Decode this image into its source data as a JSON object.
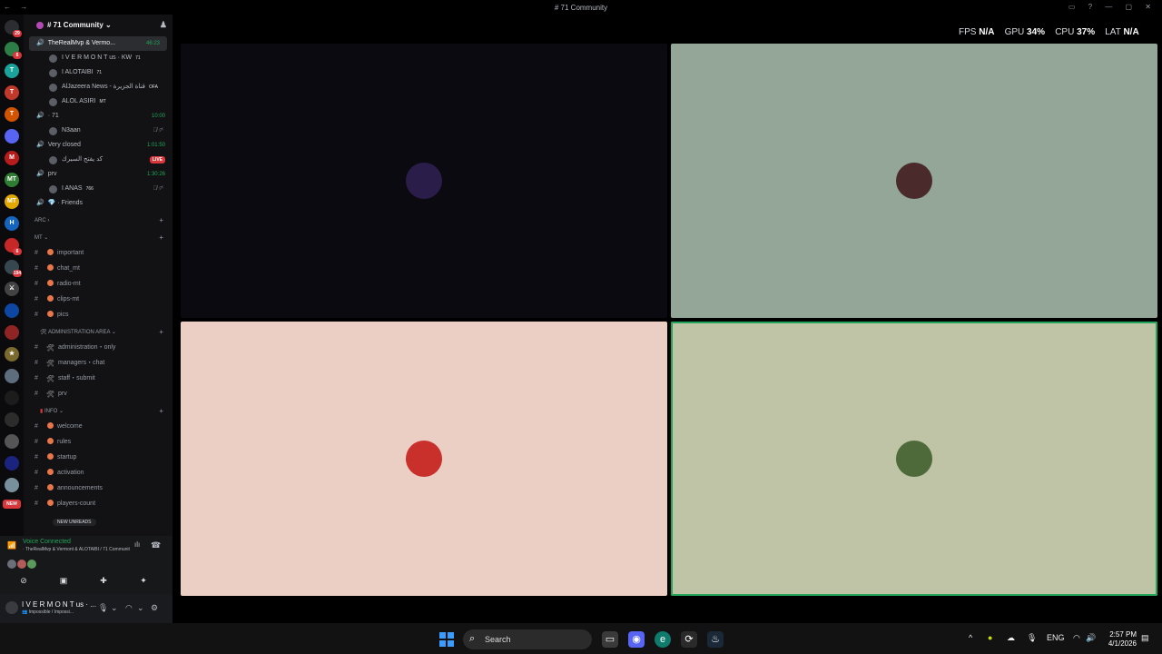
{
  "window": {
    "title": "# 71 Community",
    "nav_glyphs": "← →",
    "controls_glyphs": "▭ ? — ▢ ✕"
  },
  "server_list": {
    "items": [
      {
        "icon": "discord-home-icon",
        "color": "#2b2d31",
        "badge": "29",
        "label": ""
      },
      {
        "icon": "server-icon",
        "color": "#2d7d46",
        "badge": "6",
        "label": ""
      },
      {
        "icon": "server-icon",
        "color": "#1aa39a",
        "badge": "",
        "label": "T"
      },
      {
        "icon": "server-icon",
        "color": "#c0392b",
        "badge": "",
        "label": "T"
      },
      {
        "icon": "server-icon",
        "color": "#d35400",
        "badge": "",
        "label": "T"
      },
      {
        "icon": "server-icon",
        "color": "#5865f2",
        "badge": "",
        "label": ""
      },
      {
        "icon": "server-icon",
        "color": "#b71c1c",
        "badge": "",
        "label": "M"
      },
      {
        "icon": "server-icon",
        "color": "#2e7d32",
        "badge": "",
        "label": "MT"
      },
      {
        "icon": "server-icon",
        "color": "#e0a800",
        "badge": "",
        "label": "MT"
      },
      {
        "icon": "server-icon",
        "color": "#1565c0",
        "badge": "",
        "label": "H"
      },
      {
        "icon": "server-icon",
        "color": "#c62828",
        "badge": "6",
        "label": ""
      },
      {
        "icon": "server-icon",
        "color": "#37474f",
        "badge": "194",
        "label": ""
      },
      {
        "icon": "server-icon",
        "color": "#424242",
        "badge": "",
        "label": "⚔"
      },
      {
        "icon": "server-icon",
        "color": "#0d47a1",
        "badge": "",
        "label": ""
      },
      {
        "icon": "server-icon",
        "color": "#8e2424",
        "badge": "",
        "label": ""
      },
      {
        "icon": "server-icon",
        "color": "#7a6a2e",
        "badge": "",
        "label": "★"
      },
      {
        "icon": "server-icon",
        "color": "#5d6d7e",
        "badge": "",
        "label": ""
      },
      {
        "icon": "server-icon",
        "color": "#1c1c1c",
        "badge": "",
        "label": ""
      },
      {
        "icon": "server-icon",
        "color": "#2c2c2c",
        "badge": "",
        "label": ""
      },
      {
        "icon": "server-icon",
        "color": "#555",
        "badge": "",
        "label": ""
      },
      {
        "icon": "server-icon",
        "color": "#1a237e",
        "badge": "",
        "label": ""
      },
      {
        "icon": "server-icon",
        "color": "#78909c",
        "badge": "",
        "label": ""
      }
    ],
    "new_label": "NEW"
  },
  "sidebar": {
    "guild_name": "# 71 Community ⌄",
    "voice": [
      {
        "name": "TheRealMvp & Vermo...",
        "timer": "46:23",
        "active": true,
        "users": [
          {
            "name": "I V E R M O N T us · KW",
            "tag": "71"
          },
          {
            "name": "I ALOTAIBI",
            "tag": "71"
          },
          {
            "name": "AlJazeera News - قناة الجزيرة",
            "tag": "OFA"
          },
          {
            "name": "ALOL ASIRI",
            "tag": "MT"
          }
        ]
      },
      {
        "name": "· 71",
        "timer": "10:00",
        "active": false,
        "users": [
          {
            "name": "N3aan",
            "tag": ""
          }
        ]
      },
      {
        "name": "Very closed",
        "timer": "1:01:50",
        "active": false,
        "users": [
          {
            "name": "كد يفتح السيرك",
            "tag": "",
            "live": "LIVE"
          }
        ]
      },
      {
        "name": "prv",
        "timer": "1:30:26",
        "active": false,
        "users": [
          {
            "name": "I ANAS",
            "tag": "766"
          }
        ]
      },
      {
        "name": "💎 · Friends",
        "timer": "",
        "active": false,
        "users": []
      }
    ],
    "categories": {
      "arc": "ARC ›",
      "mt": "MT ⌄",
      "admin": "Administration Area ⌄",
      "info": "INFO ⌄"
    },
    "mt_channels": [
      "important",
      "chat_mt",
      "radio-mt",
      "clips-mt",
      "pics"
    ],
    "admin_channels": [
      "administration・only",
      "managers・chat",
      "staff・submit",
      "prv"
    ],
    "info_channels": [
      "welcome",
      "rules",
      "startup",
      "activation",
      "announcements",
      "players-count"
    ],
    "new_unreads": "NEW UNREADS"
  },
  "voice_panel": {
    "status": "Voice Connected",
    "channel": "· TheRealMvp & Vermont & ALOTAIBI / 71 Community"
  },
  "user_bar": {
    "name": "I V E R M O N T us · ...",
    "status": "👥 Impossible / Impossi..."
  },
  "hud": {
    "fps_label": "FPS",
    "fps_value": "N/A",
    "gpu_label": "GPU",
    "gpu_value": "34%",
    "cpu_label": "CPU",
    "cpu_value": "37%",
    "lat_label": "LAT",
    "lat_value": "N/A"
  },
  "tiles": [
    {
      "bg": "#0b0a10",
      "avatar": "#2a1d4a",
      "speaking": false
    },
    {
      "bg": "#93a697",
      "avatar": "#4a2a2a",
      "speaking": false
    },
    {
      "bg": "#ebcfc4",
      "avatar": "#c9302c",
      "speaking": false
    },
    {
      "bg": "#bec4a5",
      "avatar": "#4f6a3a",
      "speaking": true
    }
  ],
  "taskbar": {
    "search_label": "Search",
    "lang": "ENG",
    "time": "2:57 PM",
    "date": "4/1/2026"
  }
}
